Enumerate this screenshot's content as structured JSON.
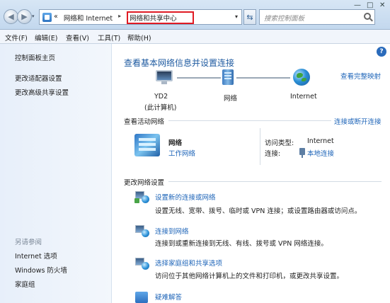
{
  "address": {
    "chevrons": "«",
    "crumb1": "网络和 Internet",
    "crumb_sep": "▸",
    "crumb2": "网络和共享中心",
    "dropdown": "▾"
  },
  "search": {
    "placeholder": "搜索控制面板"
  },
  "menu": [
    "文件(F)",
    "编辑(E)",
    "查看(V)",
    "工具(T)",
    "帮助(H)"
  ],
  "left": {
    "home": "控制面板主页",
    "links": [
      "更改适配器设置",
      "更改高级共享设置"
    ],
    "see_also_title": "另请参阅",
    "see_also": [
      "Internet 选项",
      "Windows 防火墙",
      "家庭组"
    ]
  },
  "main": {
    "title": "查看基本网络信息并设置连接",
    "full_map": "查看完整映射",
    "map": {
      "computer_name": "YD2",
      "computer_sub": "(此计算机)",
      "network": "网络",
      "internet": "Internet"
    },
    "active_header": "查看活动网络",
    "connect_link": "连接或断开连接",
    "active": {
      "name": "网络",
      "type": "工作网络",
      "access_label": "访问类型:",
      "access_value": "Internet",
      "conn_label": "连接:",
      "conn_value": "本地连接"
    },
    "change_header": "更改网络设置",
    "settings": [
      {
        "title": "设置新的连接或网络",
        "desc": "设置无线、宽带、拨号、临时或 VPN 连接；或设置路由器或访问点。"
      },
      {
        "title": "连接到网络",
        "desc": "连接到或重新连接到无线、有线、拨号或 VPN 网络连接。"
      },
      {
        "title": "选择家庭组和共享选项",
        "desc": "访问位于其他网络计算机上的文件和打印机，或更改共享设置。"
      },
      {
        "title": "疑难解答",
        "desc": ""
      }
    ]
  },
  "help": "?"
}
